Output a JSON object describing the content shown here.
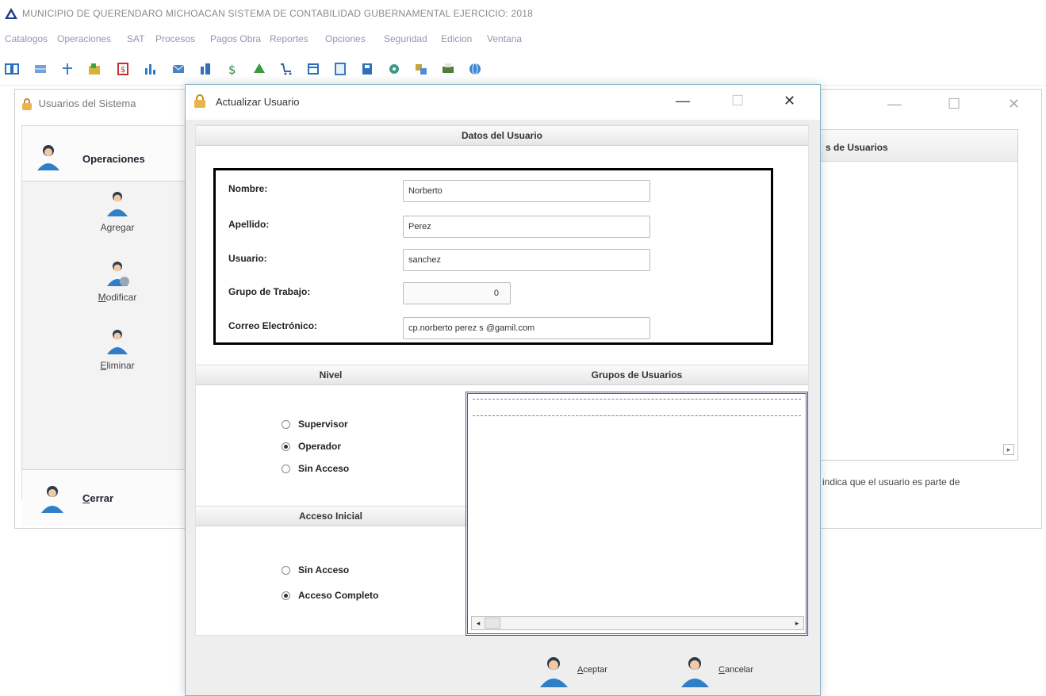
{
  "app": {
    "title": "MUNICIPIO DE QUERENDARO MICHOACAN  SISTEMA DE CONTABILIDAD GUBERNAMENTAL  EJERCICIO: 2018"
  },
  "menu": [
    {
      "label": "Catalogos"
    },
    {
      "label": "Operaciones"
    },
    {
      "label": "SAT"
    },
    {
      "label": "Procesos"
    },
    {
      "label": "Pagos Obra"
    },
    {
      "label": "Reportes"
    },
    {
      "label": "Opciones"
    },
    {
      "label": "Seguridad"
    },
    {
      "label": "Edicion"
    },
    {
      "label": "Ventana"
    }
  ],
  "toolbar_icons": [
    "grid-icon",
    "table-icon",
    "org-icon",
    "folder-icon",
    "money-icon",
    "chart-icon",
    "mail-icon",
    "report-icon",
    "dollar-icon",
    "tree-icon",
    "cart-icon",
    "window-icon",
    "doc-icon",
    "save-icon",
    "gear-icon",
    "transfer-icon",
    "print-icon",
    "globe-icon"
  ],
  "bg_window": {
    "title": "Usuarios del Sistema",
    "ops_header": "Operaciones",
    "ops": [
      {
        "label": "Agregar",
        "key": "g",
        "before": "A",
        "after": "regar"
      },
      {
        "label": "Modificar",
        "key": "M",
        "before": "",
        "after": "odificar"
      },
      {
        "label": "Eliminar",
        "key": "E",
        "before": "",
        "after": "liminar"
      }
    ],
    "close_key": "C",
    "close_rest": "errar",
    "groups_header": "s de Usuarios",
    "note": "indica que el usuario es parte de"
  },
  "dialog": {
    "title": "Actualizar Usuario",
    "section_user": "Datos del Usuario",
    "fields": {
      "nombre_label": "Nombre:",
      "nombre_value": "Norberto",
      "apellido_label": "Apellido:",
      "apellido_value": "Perez",
      "usuario_label": "Usuario:",
      "usuario_value": "sanchez",
      "grupo_label": "Grupo de Trabajo:",
      "grupo_value": "0",
      "correo_label": "Correo Electrónico:",
      "correo_value": "cp.norberto perez s @gamil.com"
    },
    "nivel": {
      "header": "Nivel",
      "options": [
        "Supervisor",
        "Operador",
        "Sin Acceso"
      ],
      "selected": "Operador"
    },
    "grupos_header": "Grupos de Usuarios",
    "acceso": {
      "header": "Acceso Inicial",
      "options": [
        "Sin Acceso",
        "Acceso Completo"
      ],
      "selected": "Acceso Completo"
    },
    "buttons": {
      "aceptar_key": "A",
      "aceptar_rest": "ceptar",
      "cancelar_key": "C",
      "cancelar_rest": "ancelar"
    }
  }
}
